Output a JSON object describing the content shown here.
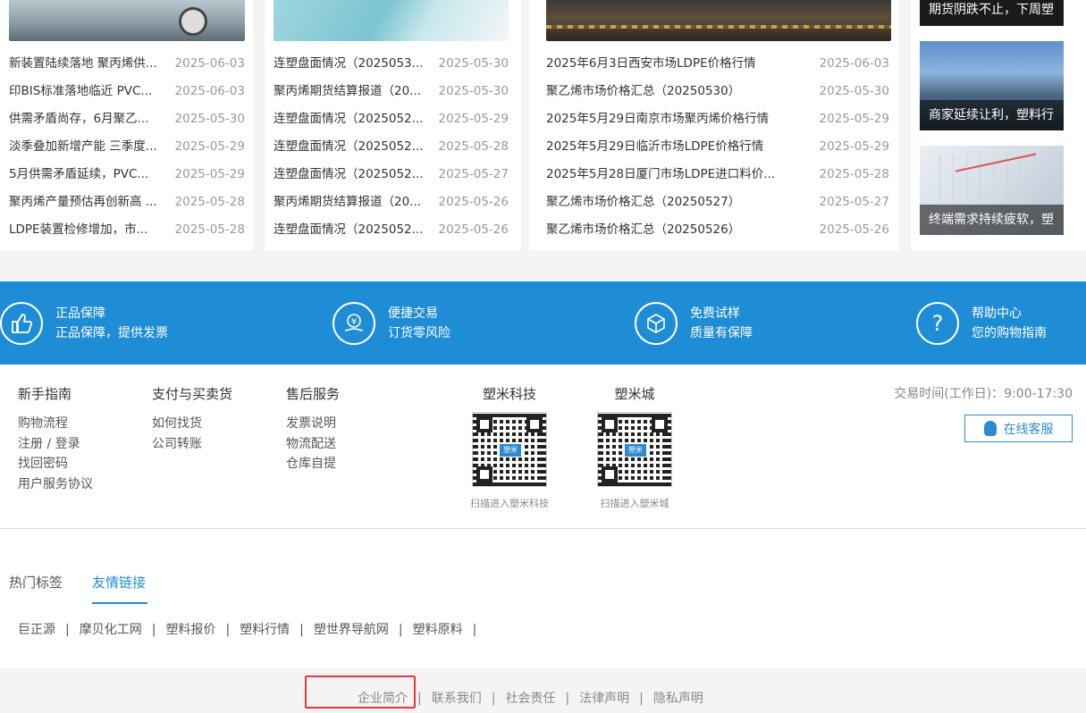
{
  "news": {
    "col1": [
      {
        "title": "新装置陆续落地 聚丙烯供...",
        "date": "2025-06-03"
      },
      {
        "title": "印BIS标准落地临近 PVC...",
        "date": "2025-06-03"
      },
      {
        "title": "供需矛盾尚存，6月聚乙...",
        "date": "2025-05-30"
      },
      {
        "title": "淡季叠加新增产能 三季度...",
        "date": "2025-05-29"
      },
      {
        "title": "5月供需矛盾延续，PVC...",
        "date": "2025-05-29"
      },
      {
        "title": "聚丙烯产量预估再创新高 ...",
        "date": "2025-05-28"
      },
      {
        "title": "LDPE装置检修增加，市...",
        "date": "2025-05-28"
      }
    ],
    "col2": [
      {
        "title": "连塑盘面情况（2025053...",
        "date": "2025-05-30"
      },
      {
        "title": "聚丙烯期货结算报道（20...",
        "date": "2025-05-30"
      },
      {
        "title": "连塑盘面情况（2025052...",
        "date": "2025-05-29"
      },
      {
        "title": "连塑盘面情况（2025052...",
        "date": "2025-05-28"
      },
      {
        "title": "连塑盘面情况（2025052...",
        "date": "2025-05-27"
      },
      {
        "title": "聚丙烯期货结算报道（20...",
        "date": "2025-05-26"
      },
      {
        "title": "连塑盘面情况（2025052...",
        "date": "2025-05-26"
      }
    ],
    "col3": [
      {
        "title": "2025年6月3日西安市场LDPE价格行情",
        "date": "2025-06-03"
      },
      {
        "title": "聚乙烯市场价格汇总（20250530）",
        "date": "2025-05-30"
      },
      {
        "title": "2025年5月29日南京市场聚丙烯价格行情",
        "date": "2025-05-29"
      },
      {
        "title": "2025年5月29日临沂市场LDPE价格行情",
        "date": "2025-05-29"
      },
      {
        "title": "2025年5月28日厦门市场LDPE进口料价...",
        "date": "2025-05-28"
      },
      {
        "title": "聚乙烯市场价格汇总（20250527）",
        "date": "2025-05-27"
      },
      {
        "title": "聚乙烯市场价格汇总（20250526）",
        "date": "2025-05-26"
      }
    ],
    "side": [
      {
        "caption": "期货阴跌不止，下周塑"
      },
      {
        "caption": "商家延续让利，塑料行"
      },
      {
        "caption": "终端需求持续疲软，塑"
      }
    ]
  },
  "services": [
    {
      "icon": "thumbs-up-icon",
      "glyph": "👍",
      "title": "正品保障",
      "desc": "正品保障，提供发票"
    },
    {
      "icon": "yen-coin-icon",
      "glyph": "¥",
      "title": "便捷交易",
      "desc": "订货零风险"
    },
    {
      "icon": "box-icon",
      "glyph": "⬡",
      "title": "免费试样",
      "desc": "质量有保障"
    },
    {
      "icon": "question-icon",
      "glyph": "?",
      "title": "帮助中心",
      "desc": "您的购物指南"
    }
  ],
  "footer": {
    "guide": {
      "title": "新手指南",
      "links": [
        "购物流程",
        "注册 / 登录",
        "找回密码",
        "用户服务协议"
      ]
    },
    "payment": {
      "title": "支付与买卖货",
      "links": [
        "如何找货",
        "公司转账"
      ]
    },
    "aftersale": {
      "title": "售后服务",
      "links": [
        "发票说明",
        "物流配送",
        "仓库自提"
      ]
    },
    "qr1": {
      "title": "塑米科技",
      "caption": "扫描进入塑米科技"
    },
    "qr2": {
      "title": "塑米城",
      "caption": "扫描进入塑米城"
    },
    "trade_time": "交易时间(工作日)：9:00-17:30",
    "kefu": "在线客服"
  },
  "tabs": {
    "hot": "热门标签",
    "friends": "友情链接"
  },
  "friend_links": [
    "巨正源",
    "摩贝化工网",
    "塑料报价",
    "塑料行情",
    "塑世界导航网",
    "塑料原料"
  ],
  "bottom_links": [
    "企业简介",
    "联系我们",
    "社会责任",
    "法律声明",
    "隐私声明"
  ],
  "colors": {
    "brand_blue": "#1e8dd5",
    "highlight_red": "#e53935"
  }
}
